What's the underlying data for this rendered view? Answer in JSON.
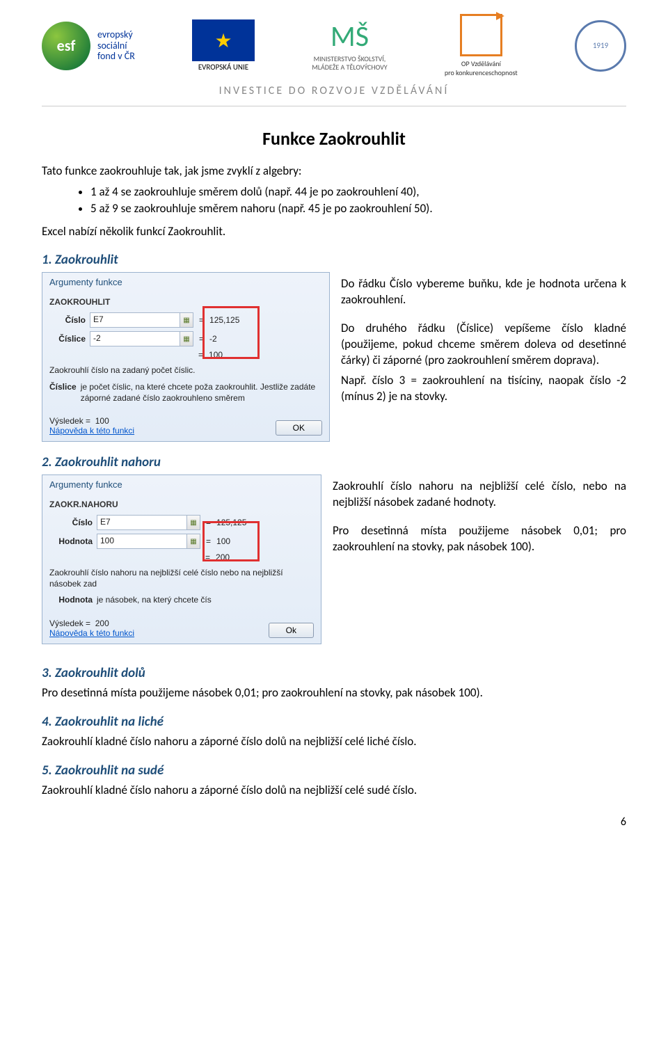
{
  "header": {
    "esf": {
      "acronym": "esf",
      "line1": "evropský",
      "line2": "sociální",
      "line3": "fond v ČR"
    },
    "eu_label": "EVROPSKÁ UNIE",
    "msmt": {
      "line1": "MINISTERSTVO ŠKOLSTVÍ,",
      "line2": "MLÁDEŽE A TĚLOVÝCHOVY"
    },
    "opvk": {
      "line1": "OP Vzdělávání",
      "line2": "pro konkurenceschopnost"
    },
    "seal": "1919",
    "investice": "INVESTICE DO ROZVOJE VZDĚLÁVÁNÍ"
  },
  "title": "Funkce Zaokrouhlit",
  "intro": "Tato funkce zaokrouhluje tak, jak jsme zvyklí z algebry:",
  "bullets": [
    "1 až 4 se zaokrouhluje směrem dolů (např. 44 je po zaokrouhlení 40),",
    "5 až 9 se zaokrouhluje směrem nahoru (např. 45 je po zaokrouhlení 50)."
  ],
  "excel_intro": "Excel nabízí několik funkcí Zaokrouhlit.",
  "sec1": {
    "head": "1. Zaokrouhlit",
    "dlg": {
      "title": "Argumenty funkce",
      "fn": "ZAOKROUHLIT",
      "f1_label": "Číslo",
      "f1_val": "E7",
      "f1_res": "125,125",
      "f2_label": "Číslice",
      "f2_val": "-2",
      "f2_res": "-2",
      "res_eq": "100",
      "desc": "Zaokrouhlí číslo na zadaný počet číslic.",
      "sub_k": "Číslice",
      "sub_v": "je počet číslic, na které chcete poža zaokrouhlit. Jestliže zadáte záporné zadané číslo zaokrouhleno směrem",
      "result_lbl": "Výsledek =",
      "result_val": "100",
      "link": "Nápověda k této funkci",
      "ok": "OK"
    },
    "p1": "Do řádku Číslo vybereme buňku, kde je hodnota určena k zaokrouhlení.",
    "p2": "Do druhého řádku (Číslice) vepíšeme číslo kladné (použijeme, pokud chceme směrem doleva od desetinné čárky) či záporné (pro zaokrouhlení směrem doprava).",
    "p3": "Např. číslo 3 = zaokrouhlení na tisíciny, naopak číslo -2 (mínus 2) je na stovky."
  },
  "sec2": {
    "head": "2. Zaokrouhlit nahoru",
    "dlg": {
      "title": "Argumenty funkce",
      "fn": "ZAOKR.NAHORU",
      "f1_label": "Číslo",
      "f1_val": "E7",
      "f1_res": "125,125",
      "f2_label": "Hodnota",
      "f2_val": "100",
      "f2_res": "100",
      "res_eq": "200",
      "desc": "Zaokrouhlí číslo nahoru na nejbližší celé číslo nebo na nejbližší násobek zad",
      "sub_k": "Hodnota",
      "sub_v": "je násobek, na který chcete čís",
      "result_lbl": "Výsledek =",
      "result_val": "200",
      "link": "Nápověda k této funkci",
      "ok": "Ok"
    },
    "p1": "Zaokrouhlí číslo nahoru na nejbližší celé číslo, nebo na nejbližší násobek zadané hodnoty.",
    "p2": "Pro desetinná místa použijeme násobek 0,01; pro zaokrouhlení na stovky, pak násobek 100)."
  },
  "sec3": {
    "head": "3. Zaokrouhlit dolů",
    "p": "Pro desetinná místa použijeme násobek 0,01; pro zaokrouhlení na stovky, pak násobek 100)."
  },
  "sec4": {
    "head": "4. Zaokrouhlit na liché",
    "p": "Zaokrouhlí kladné číslo nahoru a záporné číslo dolů na nejbližší celé liché číslo."
  },
  "sec5": {
    "head": "5. Zaokrouhlit na sudé",
    "p": "Zaokrouhlí kladné číslo nahoru a záporné číslo dolů na nejbližší celé sudé číslo."
  },
  "pagenum": "6"
}
